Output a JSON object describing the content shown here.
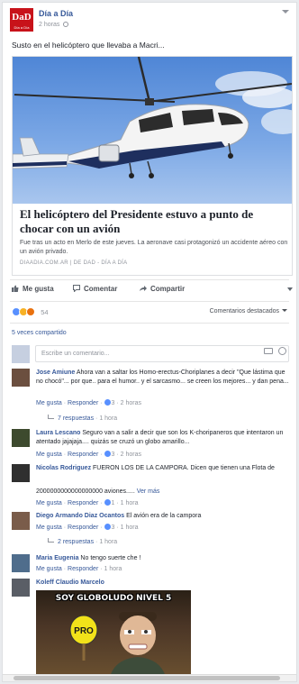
{
  "post": {
    "page_name": "Día a Día",
    "logo_text": "DaD",
    "logo_sub": "Día a Día",
    "timestamp": "2 horas",
    "text": "Susto en el helicóptero que llevaba a Macri..."
  },
  "link_preview": {
    "title": "El helicóptero del Presidente estuvo a punto de chocar con un avión",
    "description": "Fue tras un acto en Merlo de este jueves. La aeronave casi protagonizó un accidente aéreo con un avión privado.",
    "source": "DIAADIA.COM.AR | DE DAD - DÍA A DÍA"
  },
  "actions": {
    "like": "Me gusta",
    "comment": "Comentar",
    "share": "Compartir"
  },
  "reactions": {
    "count": "54",
    "featured_label": "Comentarios destacados",
    "shares": "5 veces compartido"
  },
  "compose": {
    "placeholder": "Escribe un comentario..."
  },
  "comments": [
    {
      "name": "Jose Amiune",
      "text": "Ahora van a saltar los Homo-erectus-Choriplanes a decir \"Que lástima que no chocó\"... por que.. para el humor.. y el sarcasmo... se creen los mejores... y dan pena...",
      "like": "Me gusta",
      "reply": "Responder",
      "likes": "3",
      "time": "2 horas",
      "replies": "7 respuestas",
      "replies_time": "1 hora"
    },
    {
      "name": "Laura Lescano",
      "text": "Seguro van a salir a decir que son los K-choripaneros que intentaron un atentado jajajaja.... quizás se cruzó un globo amarillo...",
      "like": "Me gusta",
      "reply": "Responder",
      "likes": "3",
      "time": "2 horas"
    },
    {
      "name": "Nicolas Rodriguez",
      "text": "FUERON LOS DE LA CAMPORA. Dicen que tienen una Flota de",
      "text2": "2000000000000000000 aviones.....",
      "see_more": "Ver más",
      "like": "Me gusta",
      "reply": "Responder",
      "likes": "1",
      "time": "1 hora"
    },
    {
      "name": "Diego Armando Diaz Ocantos",
      "text": "El avión era de la campora",
      "like": "Me gusta",
      "reply": "Responder",
      "likes": "3",
      "time": "1 hora",
      "replies": "2 respuestas",
      "replies_time": "1 hora"
    },
    {
      "name": "Maria Eugenia",
      "text": "No tengo suerte che !",
      "like": "Me gusta",
      "reply": "Responder",
      "time": "1 hora"
    },
    {
      "name": "Koleff Claudio Marcelo",
      "meme_text": "SOY GLOBOLUDO NIVEL 5",
      "sign_text": "PRO"
    }
  ]
}
